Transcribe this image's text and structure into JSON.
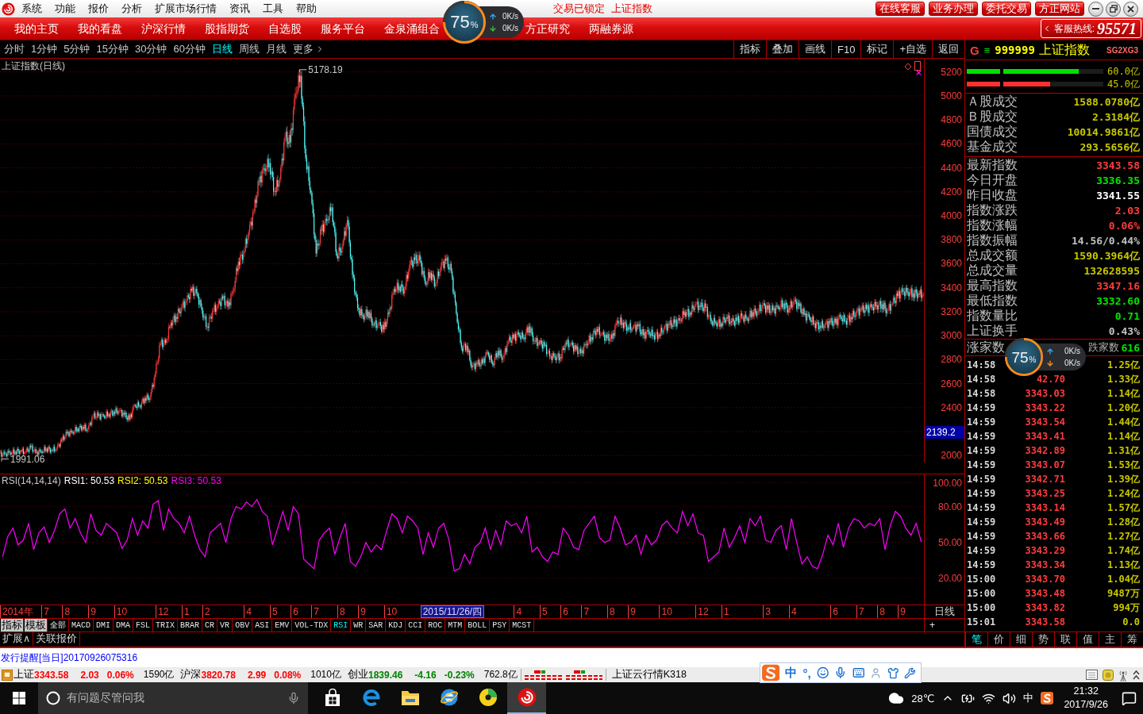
{
  "menu_bar": {
    "items": [
      "系统",
      "功能",
      "报价",
      "分析",
      "扩展市场行情",
      "资讯",
      "工具",
      "帮助"
    ],
    "notices": [
      "交易已锁定",
      "上证指数"
    ],
    "buttons": [
      "在线客服",
      "业务办理",
      "委托交易",
      "方正网站"
    ]
  },
  "nav_bar": {
    "groups": [
      [
        "我的主页",
        "我的看盘",
        "沪深行情",
        "股指期货",
        "自选股",
        "服务平台",
        "金泉涌组合"
      ],
      [
        "方正研究",
        "两融券源"
      ]
    ],
    "hotline_label": "客服热线:",
    "hotline_number": "95571"
  },
  "speed_widgets": [
    {
      "percent": "75",
      "unit": "%",
      "upload": "0K/s",
      "download": "0K/s"
    },
    {
      "percent": "75",
      "unit": "%",
      "upload": "0K/s",
      "download": "0K/s"
    }
  ],
  "period_bar": {
    "periods": [
      {
        "label": "分时",
        "selected": false
      },
      {
        "label": "1分钟",
        "selected": false
      },
      {
        "label": "5分钟",
        "selected": false
      },
      {
        "label": "15分钟",
        "selected": false
      },
      {
        "label": "30分钟",
        "selected": false
      },
      {
        "label": "60分钟",
        "selected": false
      },
      {
        "label": "日线",
        "selected": true
      },
      {
        "label": "周线",
        "selected": false
      },
      {
        "label": "月线",
        "selected": false
      }
    ],
    "more": "更多",
    "tools": [
      "指标",
      "叠加",
      "画线",
      "F10",
      "标记",
      "+自选",
      "返回"
    ]
  },
  "kline": {
    "title": "上证指数(日线)",
    "price_labels": [
      "5200",
      "5000",
      "4800",
      "4600",
      "4400",
      "4200",
      "4000",
      "3800",
      "3600",
      "3400",
      "3200",
      "3000",
      "2800",
      "2600",
      "2400",
      "2000"
    ],
    "peak_label": "5178.19",
    "low_label": "1991.06",
    "cursor_price": "2139.2",
    "date_labels": [
      "2014年",
      "7",
      "8",
      "9",
      "10",
      "12",
      "1",
      "2",
      "4",
      "5",
      "6",
      "7",
      "8",
      "9",
      "10",
      "4",
      "5",
      "6",
      "7",
      "8",
      "9",
      "10",
      "12",
      "1",
      "3",
      "4",
      "6",
      "7",
      "8",
      "9"
    ],
    "cursor_date": "2015/11/26/四",
    "axis_period": "日线"
  },
  "rsi": {
    "legend": [
      {
        "label": "RSI1: 50.53",
        "color": "#ffffff"
      },
      {
        "label": "RSI2: 50.53",
        "color": "#ffff00"
      },
      {
        "label": "RSI3: 50.53",
        "color": "#ff00ff"
      }
    ],
    "chart_data": {
      "type": "line",
      "title": "RSI(14,14,14)",
      "series": [
        {
          "color": "#ff00ff",
          "values": [
            38,
            55,
            62,
            48,
            52,
            66,
            44,
            58,
            63,
            50,
            60,
            74,
            78,
            62,
            70,
            58,
            50,
            74,
            60,
            56,
            66,
            62,
            58,
            45,
            52,
            70,
            56,
            68,
            62,
            82,
            85,
            60,
            78,
            70,
            66,
            58,
            72,
            56,
            44,
            38,
            58,
            62,
            66,
            50,
            70,
            80,
            78,
            84,
            80,
            86,
            76,
            72,
            48,
            62,
            76,
            60,
            80,
            74,
            36,
            32,
            28,
            52,
            58,
            62,
            40,
            54,
            66,
            34,
            30,
            38,
            50,
            42,
            48,
            44,
            60,
            74,
            70,
            58,
            72,
            68,
            62,
            40,
            58,
            46,
            62,
            66,
            52,
            26,
            28,
            40,
            32,
            46,
            50,
            62,
            44,
            60,
            48,
            68,
            64,
            66,
            58,
            72,
            42,
            46,
            38,
            34,
            42,
            40,
            62,
            56,
            46,
            44,
            60,
            66,
            72,
            54,
            50,
            52,
            72,
            62,
            48,
            50,
            56,
            40,
            56,
            48,
            52,
            64,
            68,
            62,
            58,
            76,
            64,
            74,
            58,
            56,
            34,
            38,
            42,
            62,
            46,
            54,
            64,
            50,
            70,
            64,
            72,
            52,
            50,
            60,
            64,
            44,
            70,
            50,
            32,
            38,
            30,
            28,
            40,
            56,
            48,
            66,
            46,
            62,
            70,
            68,
            62,
            66,
            64,
            70,
            44,
            64,
            76,
            72,
            62,
            56,
            66,
            50.5
          ]
        }
      ],
      "ylim": [
        -2,
        107
      ],
      "yticks": [
        {
          "value": 100,
          "label": "100.00"
        },
        {
          "value": 80,
          "label": "80.00"
        },
        {
          "value": 50,
          "label": "50.00"
        },
        {
          "value": 20,
          "label": "20.00"
        }
      ],
      "grid": true
    }
  },
  "indicator_bar": {
    "tools": [
      "指标",
      "模板"
    ],
    "tabs": [
      {
        "label": "全部",
        "selected": false
      },
      {
        "label": "MACD",
        "selected": false
      },
      {
        "label": "DMI",
        "selected": false
      },
      {
        "label": "DMA",
        "selected": false
      },
      {
        "label": "FSL",
        "selected": false
      },
      {
        "label": "TRIX",
        "selected": false
      },
      {
        "label": "BRAR",
        "selected": false
      },
      {
        "label": "CR",
        "selected": false
      },
      {
        "label": "VR",
        "selected": false
      },
      {
        "label": "OBV",
        "selected": false
      },
      {
        "label": "ASI",
        "selected": false
      },
      {
        "label": "EMV",
        "selected": false
      },
      {
        "label": "VOL-TDX",
        "selected": false
      },
      {
        "label": "RSI",
        "selected": true
      },
      {
        "label": "WR",
        "selected": false
      },
      {
        "label": "SAR",
        "selected": false
      },
      {
        "label": "KDJ",
        "selected": false
      },
      {
        "label": "CCI",
        "selected": false
      },
      {
        "label": "ROC",
        "selected": false
      },
      {
        "label": "MTM",
        "selected": false
      },
      {
        "label": "BOLL",
        "selected": false
      },
      {
        "label": "PSY",
        "selected": false
      },
      {
        "label": "MCST",
        "selected": false
      }
    ],
    "add": "+"
  },
  "extra_tabs": [
    "扩展∧",
    "关联报价"
  ],
  "quote": {
    "flag": "G",
    "menu_glyph": "≡",
    "code": "999999",
    "name": "上证指数",
    "tag": "SG2XG3",
    "bars": [
      {
        "color": "#00e000",
        "level": 0.82,
        "reading": "60.0亿"
      },
      {
        "color": "#ff3030",
        "level": 0.61,
        "reading": "45.0亿"
      }
    ],
    "turnover": [
      {
        "label": "Ａ股成交",
        "value": "1588.0780亿"
      },
      {
        "label": "Ｂ股成交",
        "value": "2.3184亿"
      },
      {
        "label": "国债成交",
        "value": "10014.9861亿"
      },
      {
        "label": "基金成交",
        "value": "293.5656亿"
      }
    ],
    "stats": [
      {
        "label": "最新指数",
        "value": "3343.58",
        "color": "#ff3c3c"
      },
      {
        "label": "今日开盘",
        "value": "3336.35",
        "color": "#00e600"
      },
      {
        "label": "昨日收盘",
        "value": "3341.55",
        "color": "#ffffff"
      },
      {
        "label": "指数涨跌",
        "value": "2.03",
        "color": "#ff3c3c"
      },
      {
        "label": "指数涨幅",
        "value": "0.06%",
        "color": "#ff3c3c"
      },
      {
        "label": "指数振幅",
        "value": "14.56/0.44%",
        "color": "#c0c0c0"
      },
      {
        "label": "总成交额",
        "value": "1590.3964亿",
        "color": "#c8c800"
      },
      {
        "label": "总成交量",
        "value": "132628595",
        "color": "#c8c800"
      },
      {
        "label": "最高指数",
        "value": "3347.16",
        "color": "#ff3c3c"
      },
      {
        "label": "最低指数",
        "value": "3332.60",
        "color": "#00e600"
      },
      {
        "label": "指数量比",
        "value": "0.71",
        "color": "#00e600"
      },
      {
        "label": "上证换手",
        "value": "0.43%",
        "color": "#c0c0c0"
      }
    ],
    "breadth": {
      "up_label": "涨家数",
      "down_label": "跌家数",
      "down_value": "616"
    },
    "ticks": [
      {
        "time": "14:58",
        "volume": "1.25亿"
      },
      {
        "time": "14:58",
        "price": "42.70",
        "volume": "1.33亿"
      },
      {
        "time": "14:58",
        "price": "3343.03",
        "volume": "1.14亿"
      },
      {
        "time": "14:59",
        "price": "3343.22",
        "volume": "1.20亿"
      },
      {
        "time": "14:59",
        "price": "3343.54",
        "volume": "1.44亿"
      },
      {
        "time": "14:59",
        "price": "3343.41",
        "volume": "1.14亿"
      },
      {
        "time": "14:59",
        "price": "3342.89",
        "volume": "1.31亿"
      },
      {
        "time": "14:59",
        "price": "3343.07",
        "volume": "1.53亿"
      },
      {
        "time": "14:59",
        "price": "3342.71",
        "volume": "1.39亿"
      },
      {
        "time": "14:59",
        "price": "3343.25",
        "volume": "1.24亿"
      },
      {
        "time": "14:59",
        "price": "3343.14",
        "volume": "1.57亿"
      },
      {
        "time": "14:59",
        "price": "3343.49",
        "volume": "1.28亿"
      },
      {
        "time": "14:59",
        "price": "3343.66",
        "volume": "1.27亿"
      },
      {
        "time": "14:59",
        "price": "3343.29",
        "volume": "1.74亿"
      },
      {
        "time": "14:59",
        "price": "3343.34",
        "volume": "1.13亿"
      },
      {
        "time": "15:00",
        "price": "3343.70",
        "volume": "1.04亿"
      },
      {
        "time": "15:00",
        "price": "3343.48",
        "volume": "9487万"
      },
      {
        "time": "15:00",
        "price": "3343.82",
        "volume": "994万"
      },
      {
        "time": "15:01",
        "price": "3343.58",
        "volume": "0.0"
      }
    ],
    "tabs": [
      {
        "label": "笔",
        "selected": true
      },
      {
        "label": "价",
        "selected": false
      },
      {
        "label": "细",
        "selected": false
      },
      {
        "label": "势",
        "selected": false
      },
      {
        "label": "联",
        "selected": false
      },
      {
        "label": "值",
        "selected": false
      },
      {
        "label": "主",
        "selected": false
      },
      {
        "label": "筹",
        "selected": false
      }
    ]
  },
  "message": "发行提醒[当日]20170926075316",
  "status_bar": {
    "indices": [
      {
        "name": "上证",
        "value": "3343.58",
        "change": "2.03",
        "percent": "0.06%",
        "amount": "1590亿",
        "color": "#ff0000"
      },
      {
        "name": "沪深",
        "value": "3820.78",
        "change": "2.99",
        "percent": "0.08%",
        "amount": "1010亿",
        "color": "#ff0000"
      },
      {
        "name": "创业",
        "value": "1839.46",
        "change": "-4.16",
        "percent": "-0.23%",
        "amount": "762.8亿",
        "color": "#008000"
      }
    ],
    "feed": "上证云行情K318"
  },
  "ime_toolbar": {
    "mode": "中",
    "punctuation": "°,"
  },
  "taskbar": {
    "search_placeholder": "有问题尽管问我",
    "apps": [
      {
        "kind": "store",
        "active": false
      },
      {
        "kind": "edge",
        "active": false
      },
      {
        "kind": "folder",
        "active": false
      },
      {
        "kind": "ie",
        "active": false
      },
      {
        "kind": "music",
        "active": false
      },
      {
        "kind": "trader",
        "active": true
      }
    ],
    "weather": "28℃",
    "input_mode": "中",
    "time": "21:32",
    "date": "2017/9/26"
  }
}
